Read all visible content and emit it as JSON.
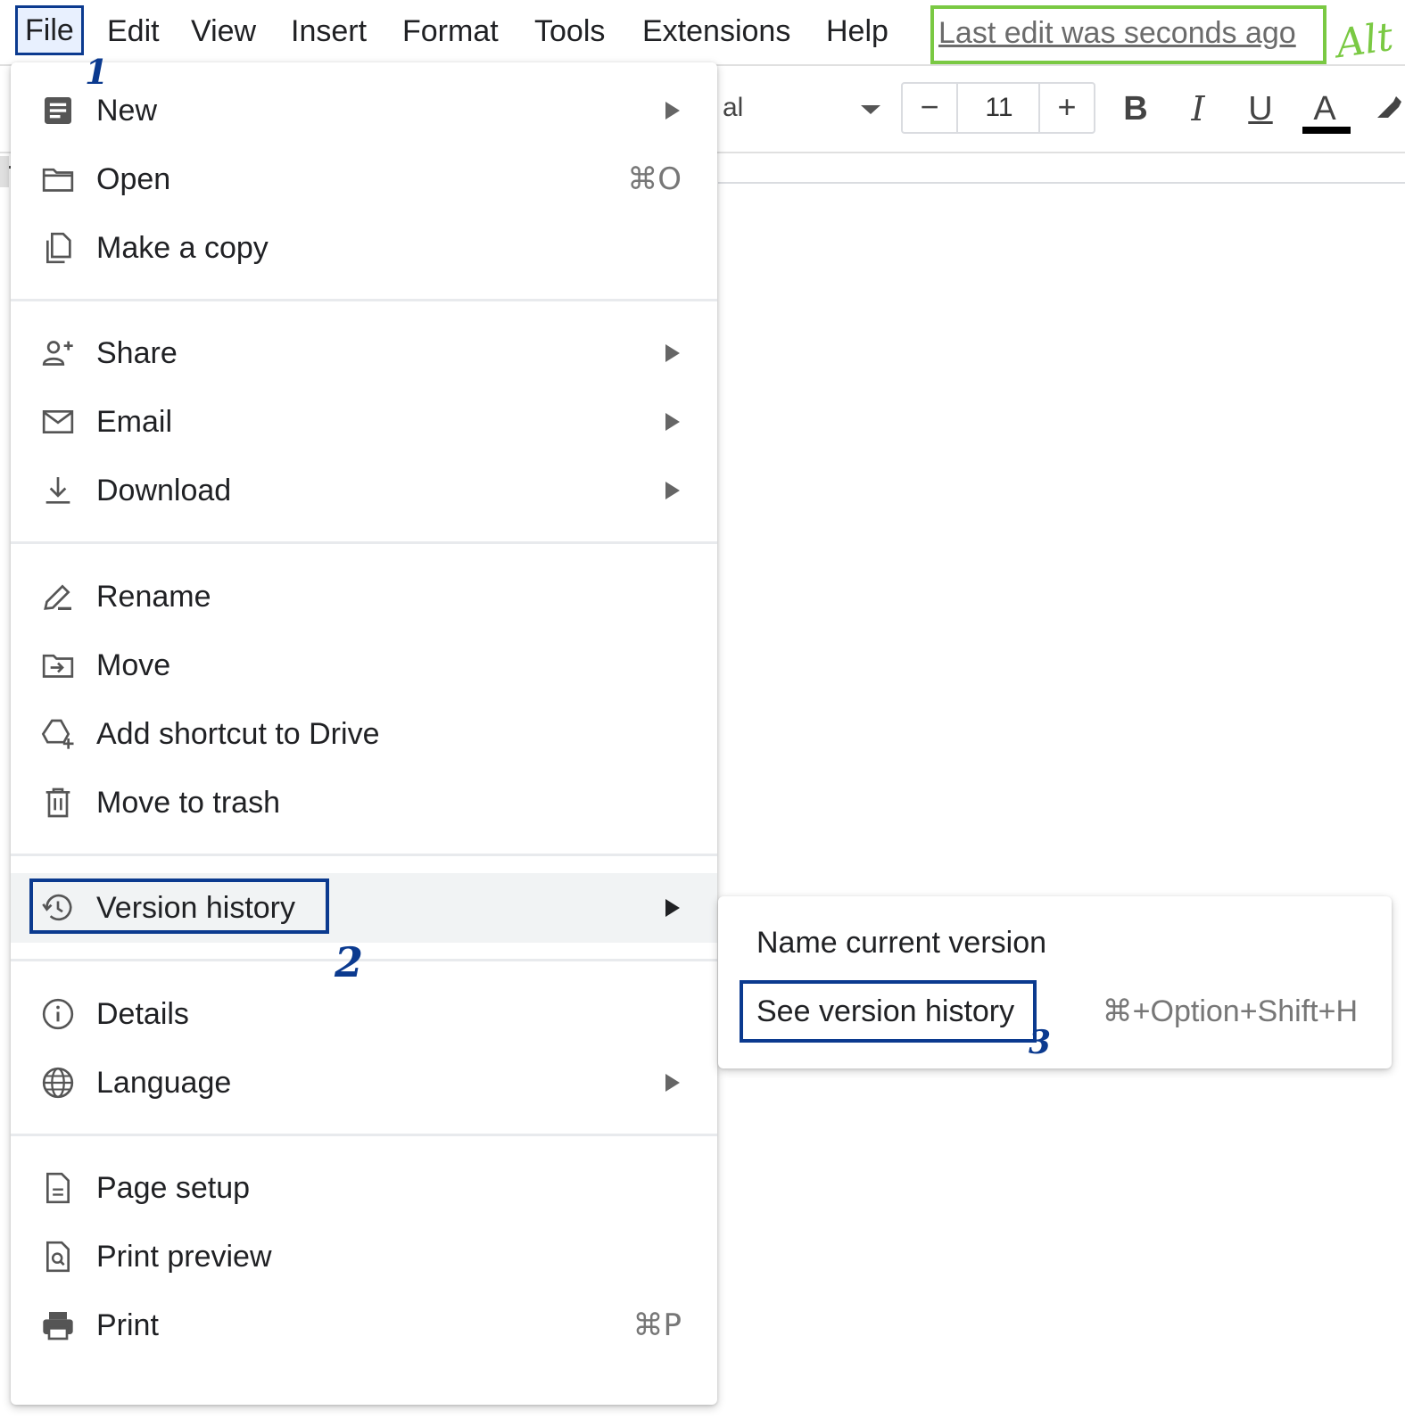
{
  "menubar": {
    "items": [
      "File",
      "Edit",
      "View",
      "Insert",
      "Format",
      "Tools",
      "Extensions",
      "Help"
    ],
    "last_edit": "Last edit was seconds ago"
  },
  "toolbar": {
    "font_name_partial": "al",
    "font_size": "11",
    "minus": "−",
    "plus": "+",
    "bold": "B",
    "italic": "I",
    "underline": "U",
    "text_color": "A",
    "text_color_value": "#000000"
  },
  "file_menu": {
    "new": "New",
    "open": "Open",
    "open_shortcut": "⌘O",
    "make_copy": "Make a copy",
    "share": "Share",
    "email": "Email",
    "download": "Download",
    "rename": "Rename",
    "move": "Move",
    "add_shortcut": "Add shortcut to Drive",
    "move_trash": "Move to trash",
    "version_history": "Version history",
    "details": "Details",
    "language": "Language",
    "page_setup": "Page setup",
    "print_preview": "Print preview",
    "print": "Print",
    "print_shortcut": "⌘P"
  },
  "version_submenu": {
    "name_current": "Name current version",
    "see_history": "See version history",
    "see_history_shortcut": "⌘+Option+Shift+H"
  },
  "annotations": {
    "step1": "1",
    "step2": "2",
    "step3": "3",
    "alt_note": "Alt"
  },
  "colors": {
    "annotation_blue": "#0b3a8f",
    "annotation_green": "#7ac943",
    "menu_hover": "#f1f3f4"
  }
}
